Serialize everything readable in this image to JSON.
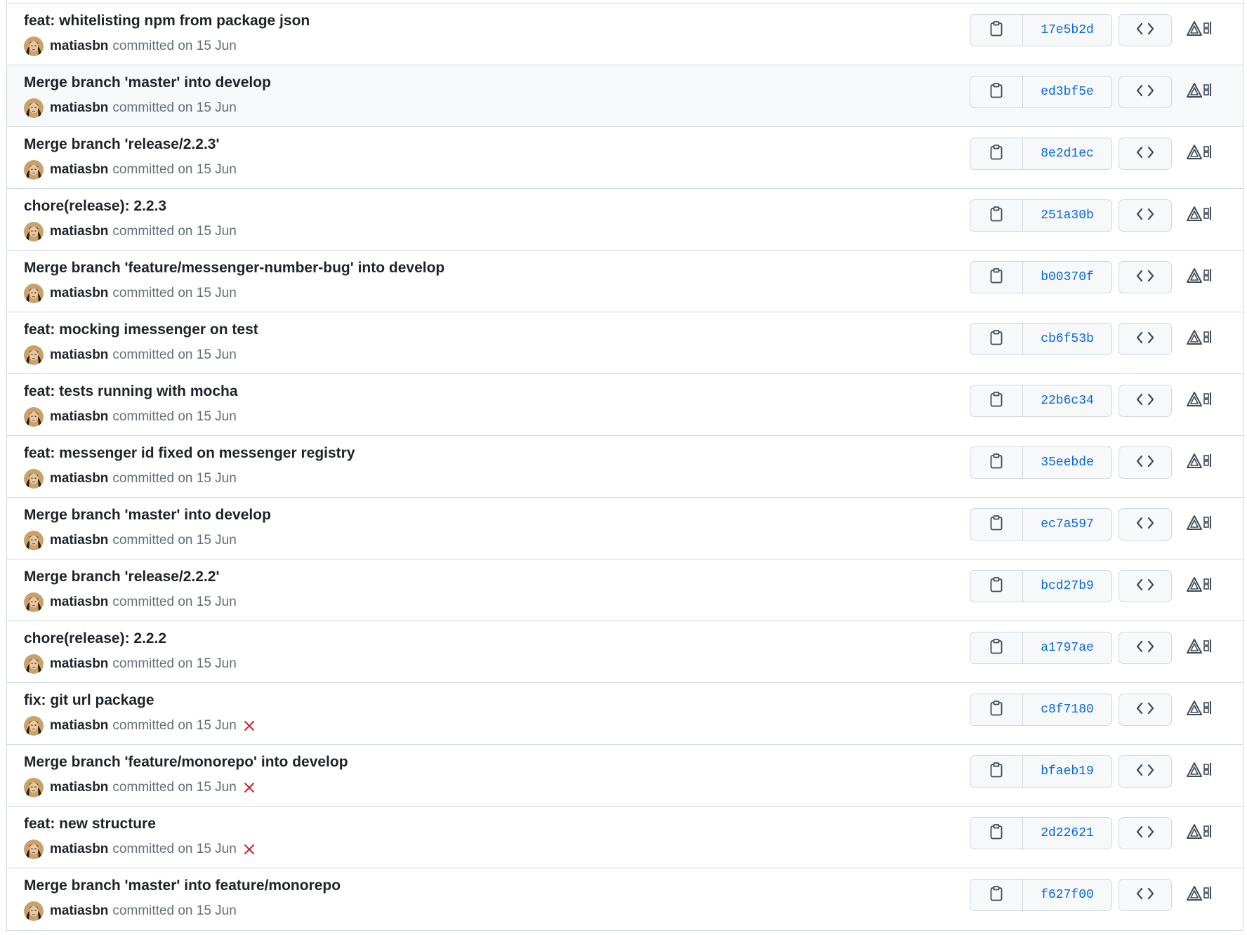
{
  "colors": {
    "border": "#d0d7de",
    "sha_link": "#0969da",
    "muted": "#656d76",
    "fail": "#cf222e",
    "hover_bg": "#f6f8fa"
  },
  "icons": {
    "copy": "clipboard-icon",
    "browse": "code-icon",
    "extension": "triangle-extension-icon",
    "fail": "x-icon"
  },
  "commits": [
    {
      "title": "feat: whitelisting npm from package json",
      "author": "matiasbn",
      "committed": "committed on 15 Jun",
      "sha": "17e5b2d",
      "failed": false
    },
    {
      "title": "Merge branch 'master' into develop",
      "author": "matiasbn",
      "committed": "committed on 15 Jun",
      "sha": "ed3bf5e",
      "failed": false
    },
    {
      "title": "Merge branch 'release/2.2.3'",
      "author": "matiasbn",
      "committed": "committed on 15 Jun",
      "sha": "8e2d1ec",
      "failed": false
    },
    {
      "title": "chore(release): 2.2.3",
      "author": "matiasbn",
      "committed": "committed on 15 Jun",
      "sha": "251a30b",
      "failed": false
    },
    {
      "title": "Merge branch 'feature/messenger-number-bug' into develop",
      "author": "matiasbn",
      "committed": "committed on 15 Jun",
      "sha": "b00370f",
      "failed": false
    },
    {
      "title": "feat: mocking imessenger on test",
      "author": "matiasbn",
      "committed": "committed on 15 Jun",
      "sha": "cb6f53b",
      "failed": false
    },
    {
      "title": "feat: tests running with mocha",
      "author": "matiasbn",
      "committed": "committed on 15 Jun",
      "sha": "22b6c34",
      "failed": false
    },
    {
      "title": "feat: messenger id fixed on messenger registry",
      "author": "matiasbn",
      "committed": "committed on 15 Jun",
      "sha": "35eebde",
      "failed": false
    },
    {
      "title": "Merge branch 'master' into develop",
      "author": "matiasbn",
      "committed": "committed on 15 Jun",
      "sha": "ec7a597",
      "failed": false
    },
    {
      "title": "Merge branch 'release/2.2.2'",
      "author": "matiasbn",
      "committed": "committed on 15 Jun",
      "sha": "bcd27b9",
      "failed": false
    },
    {
      "title": "chore(release): 2.2.2",
      "author": "matiasbn",
      "committed": "committed on 15 Jun",
      "sha": "a1797ae",
      "failed": false
    },
    {
      "title": "fix: git url package",
      "author": "matiasbn",
      "committed": "committed on 15 Jun",
      "sha": "c8f7180",
      "failed": true
    },
    {
      "title": "Merge branch 'feature/monorepo' into develop",
      "author": "matiasbn",
      "committed": "committed on 15 Jun",
      "sha": "bfaeb19",
      "failed": true
    },
    {
      "title": "feat: new structure",
      "author": "matiasbn",
      "committed": "committed on 15 Jun",
      "sha": "2d22621",
      "failed": true
    },
    {
      "title": "Merge branch 'master' into feature/monorepo",
      "author": "matiasbn",
      "committed": "committed on 15 Jun",
      "sha": "f627f00",
      "failed": false
    }
  ]
}
